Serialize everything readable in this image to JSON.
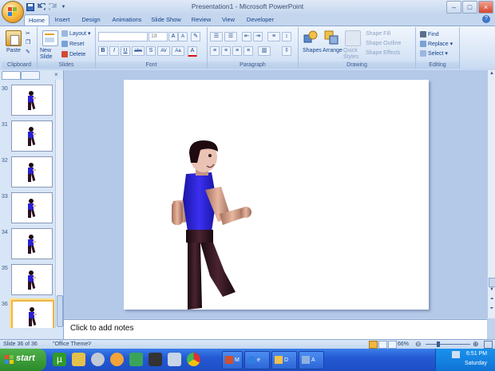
{
  "window": {
    "title": "Presentation1 - Microsoft PowerPoint"
  },
  "quick_access": {
    "save": "save-icon",
    "undo": "undo-icon",
    "redo": "redo-icon",
    "customize": "chevron-down-icon"
  },
  "window_controls": {
    "minimize": "–",
    "maximize": "□",
    "close": "×"
  },
  "tabs": [
    "Home",
    "Insert",
    "Design",
    "Animations",
    "Slide Show",
    "Review",
    "View",
    "Developer"
  ],
  "active_tab": "Home",
  "ribbon": {
    "clipboard": {
      "label": "Clipboard",
      "paste": "Paste"
    },
    "slides": {
      "label": "Slides",
      "new_slide": "New Slide",
      "layout": "Layout",
      "reset": "Reset",
      "delete": "Delete"
    },
    "font": {
      "label": "Font",
      "font_name": "",
      "font_size": "18",
      "grow": "A",
      "shrink": "A",
      "clear": "✎",
      "bold": "B",
      "italic": "I",
      "underline": "U",
      "strike": "abc",
      "shadow": "S",
      "spacing": "AV",
      "case": "Aa",
      "color": "A"
    },
    "paragraph": {
      "label": "Paragraph"
    },
    "drawing": {
      "label": "Drawing",
      "shapes": "Shapes",
      "arrange": "Arrange",
      "quick_styles": "Quick Styles",
      "shape_fill": "Shape Fill",
      "shape_outline": "Shape Outline",
      "shape_effects": "Shape Effects"
    },
    "editing": {
      "label": "Editing",
      "find": "Find",
      "replace": "Replace",
      "select": "Select"
    }
  },
  "slide_thumbnails": [
    {
      "number": "30",
      "selected": false
    },
    {
      "number": "31",
      "selected": false
    },
    {
      "number": "32",
      "selected": false
    },
    {
      "number": "33",
      "selected": false
    },
    {
      "number": "34",
      "selected": false
    },
    {
      "number": "35",
      "selected": false
    },
    {
      "number": "36",
      "selected": true
    }
  ],
  "notes": {
    "placeholder": "Click to add notes"
  },
  "status": {
    "slide": "Slide 36 of 36",
    "theme": "\"Office Theme\"",
    "zoom": "66%"
  },
  "taskbar": {
    "start": "start",
    "quick_launch": [
      "utorrent-icon",
      "pencil-icon",
      "media-icon",
      "messenger-icon",
      "network-icon",
      "film-icon",
      "grid-icon",
      "chrome-icon"
    ],
    "tasks": [
      {
        "label": "M",
        "icon": "powerpoint-icon"
      },
      {
        "label": "e",
        "icon": "ie-icon"
      },
      {
        "label": "D",
        "icon": "folder-icon"
      },
      {
        "label": "A",
        "icon": "window-icon"
      }
    ],
    "time": "6:51 PM",
    "day": "Saturday"
  },
  "colors": {
    "ribbon_bg": "#d6e4f6",
    "selected_thumb": "#f2b544",
    "shirt": "#2a1fd3",
    "taskbar": "#245edb"
  }
}
